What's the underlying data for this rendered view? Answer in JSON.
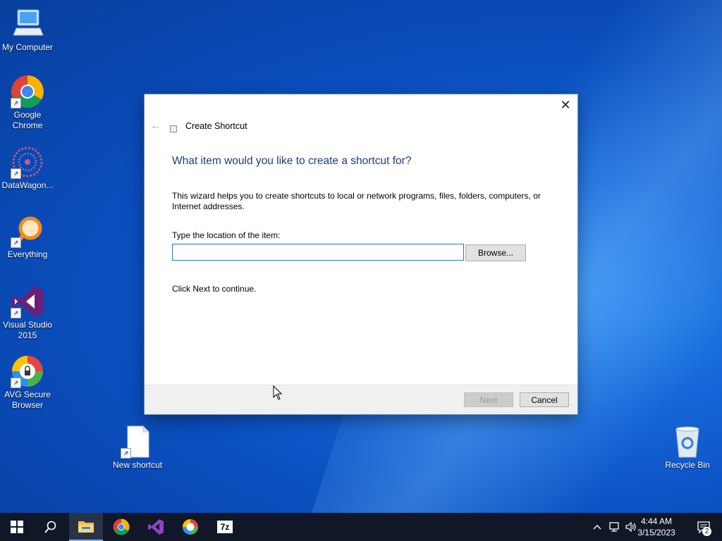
{
  "desktop": {
    "icons": [
      {
        "label": "My Computer"
      },
      {
        "label": "Google Chrome"
      },
      {
        "label": "DataWagon..."
      },
      {
        "label": "Everything"
      },
      {
        "label": "Visual Studio 2015"
      },
      {
        "label": "AVG Secure Browser"
      },
      {
        "label": "New shortcut"
      },
      {
        "label": "Recycle Bin"
      }
    ]
  },
  "dialog": {
    "title": "Create Shortcut",
    "heading": "What item would you like to create a shortcut for?",
    "description": "This wizard helps you to create shortcuts to local or network programs, files, folders, computers, or Internet addresses.",
    "location_label": "Type the location of the item:",
    "location_value": "",
    "browse_label": "Browse...",
    "continue_text": "Click Next to continue.",
    "next_label": "Next",
    "cancel_label": "Cancel",
    "close_glyph": "✕",
    "back_glyph": "←"
  },
  "taskbar": {
    "apps": [
      "start",
      "search",
      "file-explorer",
      "chrome",
      "visual-studio",
      "avg-browser",
      "7zip"
    ],
    "sevenzip_label": "7z",
    "clock_time": "4:44 AM",
    "clock_date": "3/15/2023",
    "notification_count": "2"
  },
  "colors": {
    "heading": "#1e3c78",
    "taskbar": "#101726",
    "accent": "#76b9ed"
  }
}
